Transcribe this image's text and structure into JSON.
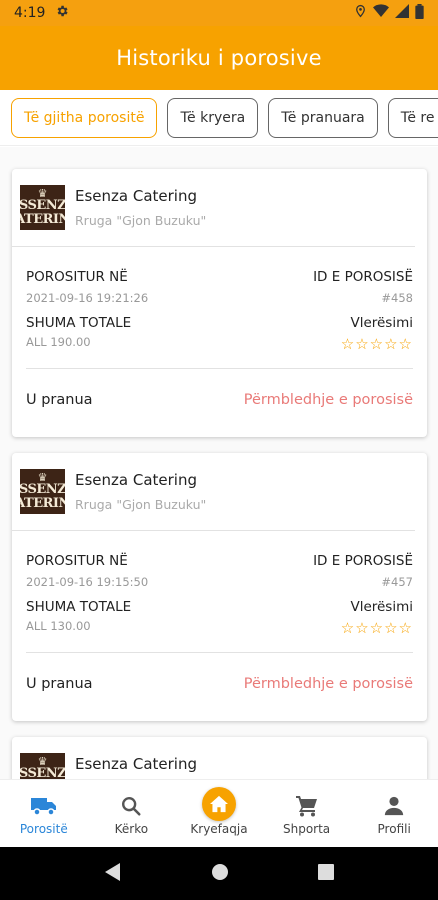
{
  "status_bar": {
    "time": "4:19"
  },
  "app_bar": {
    "title": "Historiku i porosive"
  },
  "filters": [
    {
      "label": "Të gjitha porositë",
      "active": true
    },
    {
      "label": "Të kryera",
      "active": false
    },
    {
      "label": "Të pranuara",
      "active": false
    },
    {
      "label": "Të re",
      "active": false
    }
  ],
  "labels": {
    "ordered_at": "POROSITUR NË",
    "order_id": "ID E POROSISË",
    "total": "SHUMA TOTALE",
    "rating": "Vlerësimi",
    "summary_link": "Përmbledhje e porosisë",
    "stars": "☆☆☆☆☆"
  },
  "logo": {
    "line1": "SSENZ",
    "line2": "ATERIN"
  },
  "orders": [
    {
      "restaurant": "Esenza Catering",
      "address": "Rruga \"Gjon Buzuku\"",
      "date": "2021-09-16 19:21:26",
      "id": "#458",
      "total": "ALL 190.00",
      "status": "U pranua",
      "rating": 0
    },
    {
      "restaurant": "Esenza Catering",
      "address": "Rruga \"Gjon Buzuku\"",
      "date": "2021-09-16 19:15:50",
      "id": "#457",
      "total": "ALL 130.00",
      "status": "U pranua",
      "rating": 0
    },
    {
      "restaurant": "Esenza Catering"
    }
  ],
  "bottom_nav": [
    {
      "label": "Porositë",
      "icon": "truck-icon",
      "active": true
    },
    {
      "label": "Kërko",
      "icon": "search-icon",
      "active": false
    },
    {
      "label": "Kryefaqja",
      "icon": "home-icon",
      "active": false
    },
    {
      "label": "Shporta",
      "icon": "cart-icon",
      "active": false
    },
    {
      "label": "Profili",
      "icon": "person-icon",
      "active": false
    }
  ],
  "colors": {
    "accent": "#f7a200",
    "link": "#e97a78",
    "active_nav": "#2b86d8"
  }
}
